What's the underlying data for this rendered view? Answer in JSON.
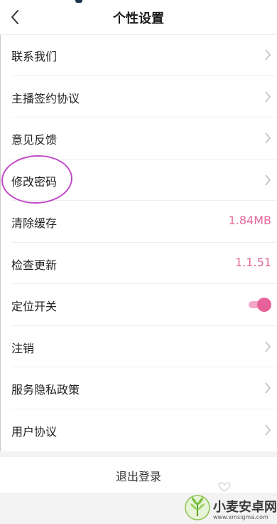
{
  "header": {
    "title": "个性设置",
    "back_icon": "chevron-left-icon"
  },
  "settings": [
    {
      "label": "联系我们",
      "kind": "link"
    },
    {
      "label": "主播签约协议",
      "kind": "link"
    },
    {
      "label": "意见反馈",
      "kind": "link"
    },
    {
      "label": "修改密码",
      "kind": "link",
      "highlighted": true
    },
    {
      "label": "清除缓存",
      "kind": "value",
      "value": "1.84MB"
    },
    {
      "label": "检查更新",
      "kind": "value",
      "value": "1.1.51"
    },
    {
      "label": "定位开关",
      "kind": "toggle",
      "on": true
    },
    {
      "label": "注销",
      "kind": "link"
    },
    {
      "label": "服务隐私政策",
      "kind": "link"
    },
    {
      "label": "用户协议",
      "kind": "link"
    }
  ],
  "logout_label": "退出登录",
  "watermark": {
    "name": "小麦安卓网",
    "url": "www.xmsigma.com"
  },
  "colors": {
    "accent": "#e4669b",
    "toggle_knob": "#e8619a",
    "annotation_circle": "#c24bc8"
  }
}
